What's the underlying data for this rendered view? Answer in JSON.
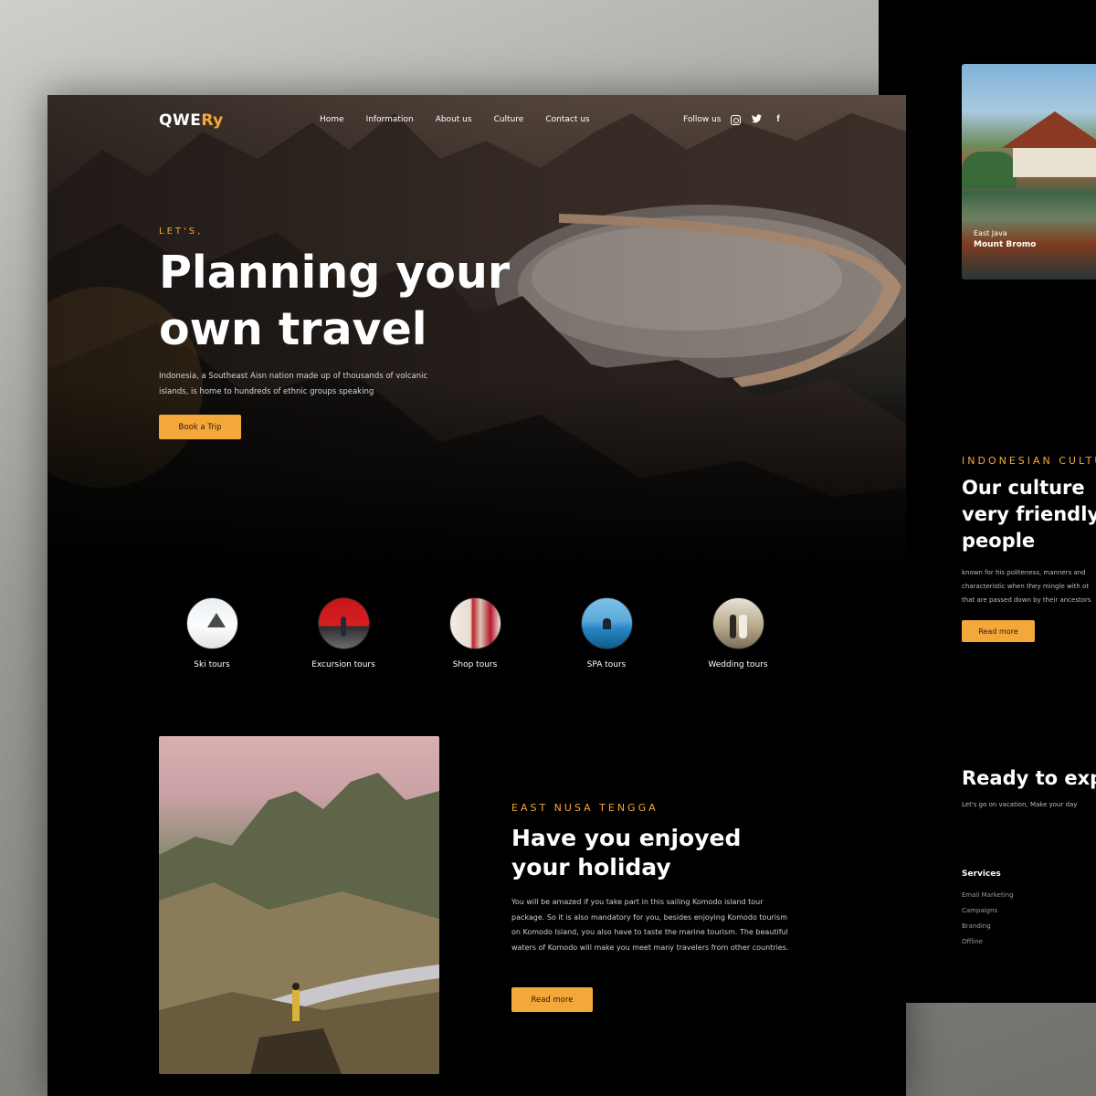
{
  "brand": {
    "logo_main": "QWE",
    "logo_accent": "Ry"
  },
  "nav": {
    "items": [
      "Home",
      "Information",
      "About us",
      "Culture",
      "Contact us"
    ],
    "follow_label": "Follow us"
  },
  "social_icons": [
    "instagram-icon",
    "twitter-icon",
    "facebook-icon"
  ],
  "hero": {
    "eyebrow": "LET'S,",
    "title": "Planning your own travel",
    "text": "Indonesia, a Southeast Aisn nation made up of thousands of volcanic islands, is home to hundreds of ethnic groups speaking",
    "button": "Book a Trip"
  },
  "tours": [
    {
      "label": "Ski tours",
      "image": "ski"
    },
    {
      "label": "Excursion tours",
      "image": "excursion"
    },
    {
      "label": "Shop tours",
      "image": "shop"
    },
    {
      "label": "SPA tours",
      "image": "spa"
    },
    {
      "label": "Wedding tours",
      "image": "wedding"
    }
  ],
  "holiday": {
    "eyebrow": "EAST NUSA TENGGA",
    "title": "Have you enjoyed your holiday",
    "text": "You will be amazed if you take part in this sailing Komodo island tour package. So it is also mandatory for you, besides enjoying Komodo tourism on Komodo Island, you also have to taste the marine tourism. The beautiful waters of Komodo will make you meet many travelers from other countries.",
    "button": "Read more"
  },
  "side": {
    "card": {
      "location": "East Java",
      "name": "Mount Bromo"
    },
    "culture": {
      "eyebrow": "INDONESIAN CULTU",
      "title_lines": [
        "Our culture",
        "very friendly",
        "people"
      ],
      "body_lines": [
        "known for his politeness, manners and",
        "characteristic when they mingle with ot",
        "that are passed down by their ancestors"
      ],
      "button": "Read more"
    },
    "ready": {
      "title": "Ready to exp",
      "subtitle": "Let's go on vacation, Make your day"
    },
    "services": {
      "title": "Services",
      "items": [
        "Email Marketing",
        "Campaigns",
        "Branding",
        "Offline"
      ]
    }
  },
  "colors": {
    "accent": "#f5a83a",
    "page_bg": "#000000",
    "text": "#ffffff"
  }
}
